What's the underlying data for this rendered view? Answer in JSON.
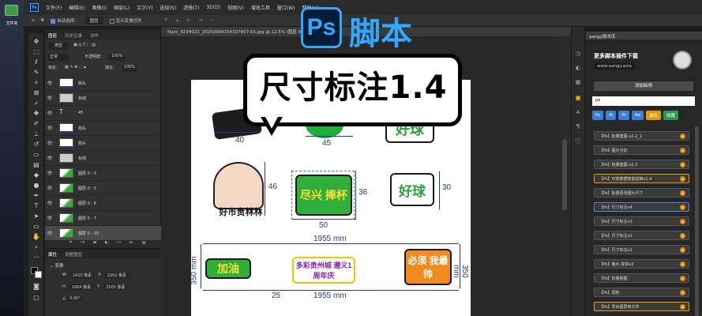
{
  "desktop": {
    "folder_label": "文件夹"
  },
  "menu": [
    "文件(F)",
    "编辑(E)",
    "图像(I)",
    "图层(L)",
    "文字(Y)",
    "选择(S)",
    "滤镜(T)",
    "3D(D)",
    "视图(V)",
    "增效工具",
    "窗口(W)",
    "帮助(H)"
  ],
  "options": {
    "auto_select": "自动选择：",
    "auto_select_value": "图层",
    "show_transform": "显示变换控件"
  },
  "doc_tab": "Nipic_9234021_20250904154107807-01.jpg @ 12.5% (图层 0 - 10, CMYK/8)",
  "layers": {
    "tabs": [
      "图层",
      "历史记录",
      "动作"
    ],
    "filter": "类型",
    "blend": "正常",
    "opacity_label": "不透明度：",
    "opacity": "100%",
    "lock_label": "锁定：",
    "fill_label": "填充：",
    "fill": "100%",
    "rows": [
      {
        "name": "箭头",
        "kind": "arrow"
      },
      {
        "name": "标线",
        "kind": "line"
      },
      {
        "name": "45",
        "kind": "text"
      },
      {
        "name": "箭头",
        "kind": "arrow"
      },
      {
        "name": "箭头",
        "kind": "arrow"
      },
      {
        "name": "标线",
        "kind": "line"
      },
      {
        "name": "图层 0 - 3",
        "kind": "img"
      },
      {
        "name": "图层 0 - 5",
        "kind": "img"
      },
      {
        "name": "图层 0 - 6",
        "kind": "img"
      },
      {
        "name": "图层 0 - 7",
        "kind": "img"
      },
      {
        "name": "图层 0 - 10",
        "kind": "img"
      }
    ]
  },
  "properties": {
    "tabs": [
      "属性",
      "调整图层"
    ],
    "section": "变换",
    "w_label": "W",
    "w": "1410 像素",
    "x_label": "X",
    "x": "2202 像素",
    "h_label": "H",
    "h": "1064 像素",
    "y_label": "Y",
    "y": "2505 像素",
    "angle": "0.00°"
  },
  "canvas": {
    "bubble_text": "尺寸标注1.4",
    "ps_badge": "Ps",
    "ps_title": "脚本",
    "dims": [
      "40",
      "45",
      "46",
      "38",
      "30",
      "50",
      "1955 mm",
      "350 mm",
      "350 mm",
      "25",
      "1955 mm"
    ],
    "stickers": [
      "好球",
      "尽兴 捧杯",
      "好球",
      "加油",
      "多彩贵州城 遵义1周年庆",
      "必须 我最帅",
      "好市贵林林"
    ]
  },
  "plugin": {
    "header": "aangy脚本库",
    "title": "更多脚本插件下载",
    "site": "www.aangy.asia",
    "add_btn": "添加新项",
    "search_value": "ps",
    "filters": [
      {
        "label": "Ps",
        "color": "#3b7dd8"
      },
      {
        "label": "Ai",
        "color": "#3b7dd8"
      },
      {
        "label": "Pr",
        "color": "#3b7dd8"
      },
      {
        "label": "Ae",
        "color": "#3b7dd8"
      },
      {
        "label": "最佳",
        "color": "#e09a00"
      },
      {
        "label": "收藏",
        "color": "#2a9a4a"
      }
    ],
    "items": [
      {
        "label": "【Ps】批量套图-v2.2_1",
        "state": ""
      },
      {
        "label": "【Ps】图片分切",
        "state": ""
      },
      {
        "label": "【Ps】批量套图-v2.2",
        "state": ""
      },
      {
        "label": "【Ps】可变数据智能替换v1.4",
        "state": "hl"
      },
      {
        "label": "【Ps】批量更改图片尺寸",
        "state": ""
      },
      {
        "label": "【Ps】尺寸标注v4",
        "state": "sel"
      },
      {
        "label": "【Ps】尺寸标注v3",
        "state": ""
      },
      {
        "label": "【Ps】尺寸标注v2",
        "state": ""
      },
      {
        "label": "【Ps】尺寸标注v1",
        "state": ""
      },
      {
        "label": "【Ps】裁片-复杂v2",
        "state": ""
      },
      {
        "label": "【Ps】批量刷图",
        "state": ""
      },
      {
        "label": "【Ps】调色",
        "state": ""
      },
      {
        "label": "【Ps】导出图层到文件",
        "state": "hl"
      }
    ]
  },
  "colors": {
    "accent": "#31a8ff",
    "dim": "#2a3a8a",
    "highlight": "#e0a300"
  }
}
